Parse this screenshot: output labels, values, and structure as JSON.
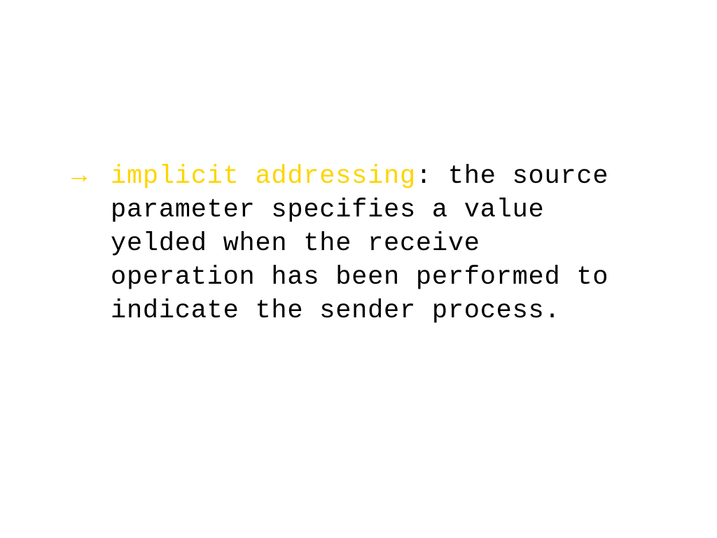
{
  "slide": {
    "highlighted_term": "implicit addressing",
    "body_text": ": the source parameter specifies a value yelded when the receive operation has been performed to indicate the sender process."
  }
}
